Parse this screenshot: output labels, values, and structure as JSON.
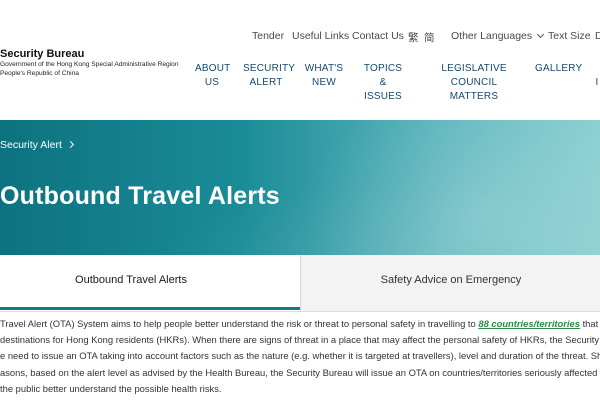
{
  "header": {
    "utility_links": {
      "tender": "Tender",
      "useful_links": "Useful Links",
      "contact_us": "Contact Us",
      "lang_trad": "繁",
      "lang_simp": "简",
      "other_languages": "Other Languages",
      "text_size": "Text Size",
      "overflow": "D"
    },
    "logo": {
      "title": "Security Bureau",
      "sub_line1": "Government of the Hong Kong Special Administrative Region",
      "sub_line2": "People's Republic of China"
    },
    "main_nav": {
      "about_line1": "ABOUT",
      "about_line2": "US",
      "security_line1": "SECURITY",
      "security_line2": "ALERT",
      "whats_line1": "WHAT'S",
      "whats_line2": "NEW",
      "topics_line1": "TOPICS &",
      "topics_line2": "ISSUES",
      "legco_line1": "LEGISLATIVE COUNCIL",
      "legco_line2": "MATTERS",
      "gallery": "GALLERY",
      "overflow": "I"
    }
  },
  "banner": {
    "breadcrumb": "Security Alert",
    "title": "Outbound Travel Alerts"
  },
  "tabs": {
    "active": "Outbound Travel Alerts",
    "inactive": "Safety Advice on Emergency"
  },
  "body": {
    "line1_a": "Travel Alert (OTA) System aims to help people better understand the risk or threat to personal safety in travelling to ",
    "line1_link": "88 countries/territories",
    "line1_b": " that are",
    "line2": "destinations for Hong Kong residents (HKRs). When there are signs of threat in a place that may affect the personal safety of HKRs, the Security Bureau",
    "line3": "e need to issue an OTA taking into account factors such as the nature (e.g. whether it is targeted at travellers), level and duration of the threat. Should",
    "line4": "asons, based on the alert level as advised by the Health Bureau, the Security Bureau will issue an OTA on countries/territories seriously affected by i",
    "line5": "the public better understand the possible health risks."
  },
  "colors": {
    "nav_text": "#15496e",
    "banner_teal": "#0d7280",
    "tab_underline": "#137a86",
    "link_green": "#2a8a44"
  }
}
